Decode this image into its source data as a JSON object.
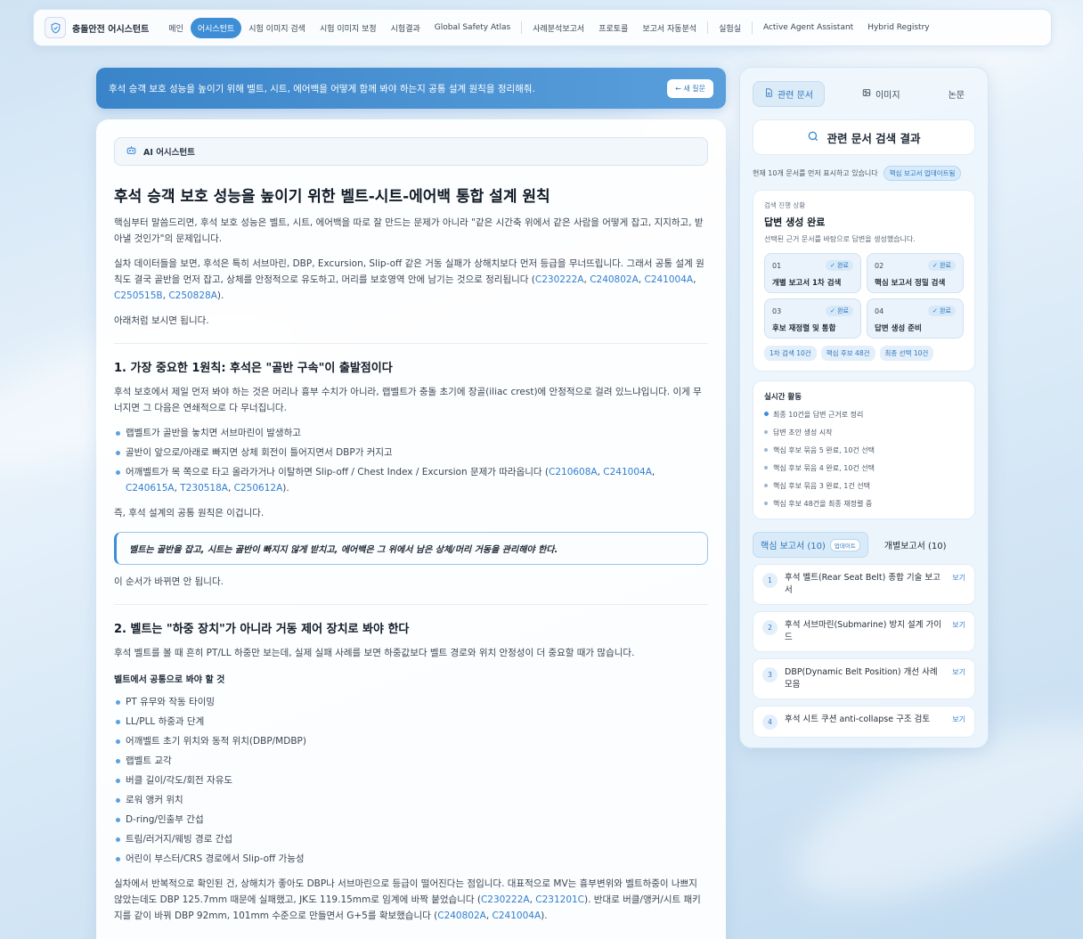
{
  "nav": {
    "brand": "충돌안전 어시스턴트",
    "items": [
      "메인",
      "어시스턴트",
      "시험 이미지 검색",
      "시험 이미지 보정",
      "시험결과",
      "Global Safety Atlas",
      "사례분석보고서",
      "프로토콜",
      "보고서 자동분석",
      "실험실",
      "Active Agent Assistant",
      "Hybrid Registry"
    ],
    "active": "어시스턴트"
  },
  "question": {
    "text": "후석 승객 보호 성능을 높이기 위해 벨트, 시트, 에어백을 어떻게 함께 봐야 하는지 공통 설계 원칙을 정리해줘.",
    "new_button": "← 새 질문"
  },
  "answer": {
    "chip": "AI 어시스턴트",
    "title": "후석 승객 보호 성능을 높이기 위한 벨트-시트-에어백 통합 설계 원칙",
    "p1": "핵심부터 말씀드리면, 후석 보호 성능은 벨트, 시트, 에어백을 따로 잘 만드는 문제가 아니라 \"같은 시간축 위에서 같은 사람을 어떻게 잡고, 지지하고, 받아낼 것인가\"의 문제입니다.",
    "p2_text": "실차 데이터들을 보면, 후석은 특히 서브마린, DBP, Excursion, Slip-off 같은 거동 실패가 상해치보다 먼저 등급을 무너뜨립니다. 그래서 공통 설계 원칙도 결국 골반을 먼저 잡고, 상체를 안정적으로 유도하고, 머리를 보호영역 안에 남기는 것으로 정리됩니다 (",
    "p2_refs": [
      "C230222A",
      "C240802A",
      "C241004A",
      "C250515B",
      "C250828A"
    ],
    "p3": "아래처럼 보시면 됩니다.",
    "s1": {
      "heading": "1. 가장 중요한 1원칙: 후석은 \"골반 구속\"이 출발점이다",
      "para": "후석 보호에서 제일 먼저 봐야 하는 것은 머리나 흉부 수치가 아니라, 랩벨트가 충돌 초기에 장골(iliac crest)에 안정적으로 걸려 있느냐입니다. 이게 무너지면 그 다음은 연쇄적으로 다 무너집니다.",
      "bullets": [
        "랩벨트가 골반을 놓치면 서브마린이 발생하고",
        "골반이 앞으로/아래로 빠지면 상체 회전이 틀어지면서 DBP가 커지고"
      ],
      "bullet3_text": "어깨벨트가 목 쪽으로 타고 올라가거나 이탈하면 Slip-off / Chest Index / Excursion 문제가 따라옵니다 (",
      "bullet3_refs": [
        "C210608A",
        "C241004A",
        "C240615A",
        "T230518A",
        "C250612A"
      ],
      "lead": "즉, 후석 설계의 공통 원칙은 이겁니다.",
      "callout": "벨트는 골반을 잡고, 시트는 골반이 빠지지 않게 받치고, 에어백은 그 위에서 남은 상체/머리 거동을 관리해야 한다.",
      "tail": "이 순서가 바뀌면 안 됩니다."
    },
    "s2": {
      "heading": "2. 벨트는 \"하중 장치\"가 아니라 거동 제어 장치로 봐야 한다",
      "para": "후석 벨트를 볼 때 흔히 PT/LL 하중만 보는데, 실제 실패 사례를 보면 하중값보다 벨트 경로와 위치 안정성이 더 중요할 때가 많습니다.",
      "subhead": "벨트에서 공통으로 봐야 할 것",
      "bullets": [
        "PT 유무와 작동 타이밍",
        "LL/PLL 하중과 단계",
        "어깨벨트 초기 위치와 동적 위치(DBP/MDBP)",
        "랩벨트 교각",
        "버클 길이/각도/회전 자유도",
        "로워 앵커 위치",
        "D-ring/인출부 간섭",
        "트림/러거지/웨빙 경로 간섭",
        "어린이 부스터/CRS 경로에서 Slip-off 가능성"
      ],
      "para2_text": "실차에서 반복적으로 확인된 건, 상해치가 좋아도 DBP나 서브마린으로 등급이 떨어진다는 점입니다. 대표적으로 MV는 흉부변위와 벨트하중이 나쁘지 않았는데도 DBP 125.7mm 때문에 실패했고, JK도 119.15mm로 임계에 바짝 붙었습니다 (",
      "para2_refs_a": [
        "C230222A",
        "C231201C"
      ],
      "para2_mid": "). 반대로 버클/앵커/시트 패키지를 같이 바꿔 DBP 92mm, 101mm 수준으로 만들면서 G+5를 확보했습니다 (",
      "para2_refs_b": [
        "C240802A",
        "C241004A"
      ]
    }
  },
  "side": {
    "tabs": [
      "관련 문서",
      "이미지",
      "논문"
    ],
    "search_title": "관련 문서 검색 결과",
    "info": "현재 10개 문서를 먼저 표시하고 있습니다",
    "info_badge": "핵심 보고서 업데이트됨",
    "progress": {
      "label": "검색 진행 상황",
      "title": "답변 생성 완료",
      "sub": "선택된 근거 문서를 바탕으로 답변을 생성했습니다.",
      "done_label": "✓ 완료",
      "steps": [
        {
          "num": "01",
          "name": "개별 보고서 1차 검색"
        },
        {
          "num": "02",
          "name": "핵심 보고서 정밀 검색"
        },
        {
          "num": "03",
          "name": "후보 재정렬 및 통합"
        },
        {
          "num": "04",
          "name": "답변 생성 준비"
        }
      ],
      "stats": [
        "1차 검색 10건",
        "핵심 후보 48건",
        "최종 선택 10건"
      ]
    },
    "activity": {
      "title": "실시간 활동",
      "items": [
        "최종 10건을 답변 근거로 정리",
        "답변 초안 생성 시작",
        "핵심 후보 묶음 5 완료, 10건 선택",
        "핵심 후보 묶음 4 완료, 10건 선택",
        "핵심 후보 묶음 3 완료, 1건 선택",
        "핵심 후보 48건을 최종 재정렬 중"
      ]
    },
    "report_tabs": {
      "core": "핵심 보고서 (10)",
      "core_badge": "업데이트",
      "individual": "개별보고서 (10)"
    },
    "view_label": "보기",
    "reports": [
      {
        "n": "1",
        "title": "후석 벨트(Rear Seat Belt) 종합 기술 보고서"
      },
      {
        "n": "2",
        "title": "후석 서브마린(Submarine) 방지 설계 가이드"
      },
      {
        "n": "3",
        "title": "DBP(Dynamic Belt Position) 개선 사례 모음"
      },
      {
        "n": "4",
        "title": "후석 시트 쿠션 anti-collapse 구조 검토"
      }
    ]
  }
}
